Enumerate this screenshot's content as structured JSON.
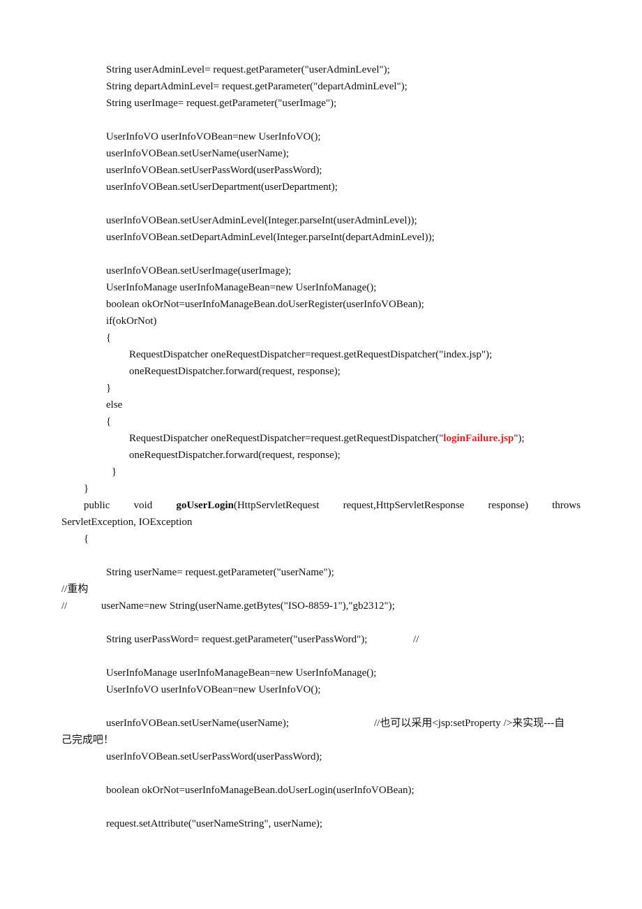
{
  "document": {
    "lines": [
      "String userAdminLevel= request.getParameter(\"userAdminLevel\");",
      "String departAdminLevel= request.getParameter(\"departAdminLevel\");",
      "String userImage= request.getParameter(\"userImage\");",
      "UserInfoVO userInfoVOBean=new UserInfoVO();",
      "userInfoVOBean.setUserName(userName);",
      "userInfoVOBean.setUserPassWord(userPassWord);",
      "userInfoVOBean.setUserDepartment(userDepartment);",
      "userInfoVOBean.setUserAdminLevel(Integer.parseInt(userAdminLevel));",
      "userInfoVOBean.setDepartAdminLevel(Integer.parseInt(departAdminLevel));",
      "userInfoVOBean.setUserImage(userImage);",
      "UserInfoManage userInfoManageBean=new UserInfoManage();",
      "boolean okOrNot=userInfoManageBean.doUserRegister(userInfoVOBean);",
      "if(okOrNot)",
      "{",
      "RequestDispatcher oneRequestDispatcher=request.getRequestDispatcher(\"index.jsp\");",
      "oneRequestDispatcher.forward(request, response);",
      "}",
      "else",
      "{",
      "oneRequestDispatcher.forward(request, response);",
      "}",
      "}"
    ],
    "failure_line": {
      "prefix": "RequestDispatcher oneRequestDispatcher=request.getRequestDispatcher(\"",
      "highlight": "loginFailure.jsp",
      "suffix": "\");"
    },
    "method_signature": {
      "w1": "public",
      "w2": "void",
      "name": "goUserLogin",
      "w3": "(HttpServletRequest",
      "w4": "request,HttpServletResponse",
      "w5": "response)",
      "w6": "throws",
      "continuation": "ServletException, IOException"
    },
    "login_lines": [
      "{",
      "String userName= request.getParameter(\"userName\");",
      "//重构",
      "//",
      "userName=new String(userName.getBytes(\"ISO-8859-1\"),\"gb2312\");",
      "String userPassWord= request.getParameter(\"userPassWord\");",
      "//",
      "UserInfoManage userInfoManageBean=new UserInfoManage();",
      "UserInfoVO userInfoVOBean=new UserInfoVO();",
      "userInfoVOBean.setUserName(userName);",
      "//也可以采用<jsp:setProperty />来实现---自",
      "己完成吧！",
      "userInfoVOBean.setUserPassWord(userPassWord);",
      "boolean okOrNot=userInfoManageBean.doUserLogin(userInfoVOBean);",
      "request.setAttribute(\"userNameString\", userName);"
    ],
    "highlight_color": "#d3262b"
  }
}
